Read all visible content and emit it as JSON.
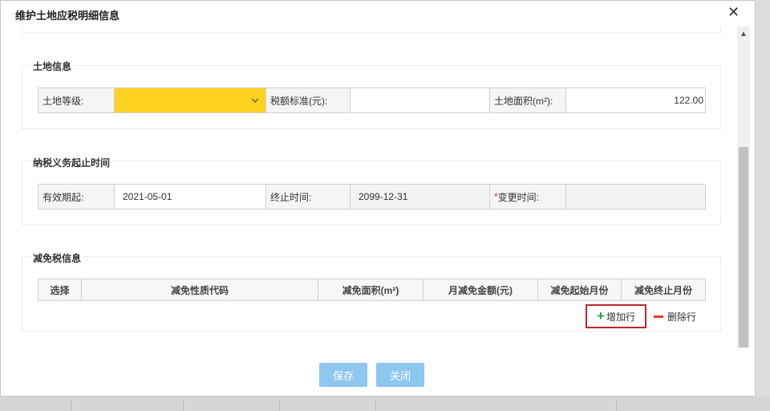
{
  "modal": {
    "title": "维护土地应税明细信息"
  },
  "land_info": {
    "section_title": "土地信息",
    "grade_label": "土地等级:",
    "grade_value": "",
    "tax_standard_label": "税额标准(元):",
    "tax_standard_value": "",
    "area_label": "土地面积(m²):",
    "area_value": "122.00"
  },
  "tax_period": {
    "section_title": "纳税义务起止时间",
    "effective_label": "有效期起:",
    "effective_value": "2021-05-01",
    "end_label": "终止时间:",
    "end_value": "2099-12-31",
    "change_label_required": "*",
    "change_label": "变更时间:",
    "change_value": ""
  },
  "relief": {
    "section_title": "减免税信息",
    "columns": [
      "选择",
      "减免性质代码",
      "减免面积(m²)",
      "月减免金额(元)",
      "减免起始月份",
      "减免终止月份"
    ],
    "add_row_label": "增加行",
    "delete_row_label": "删除行"
  },
  "footer": {
    "save_label": "保存",
    "close_label": "关闭"
  },
  "colors": {
    "accent_yellow": "#ffd21f",
    "button_blue": "#8ec7f0",
    "highlight_red": "#c0282d"
  }
}
